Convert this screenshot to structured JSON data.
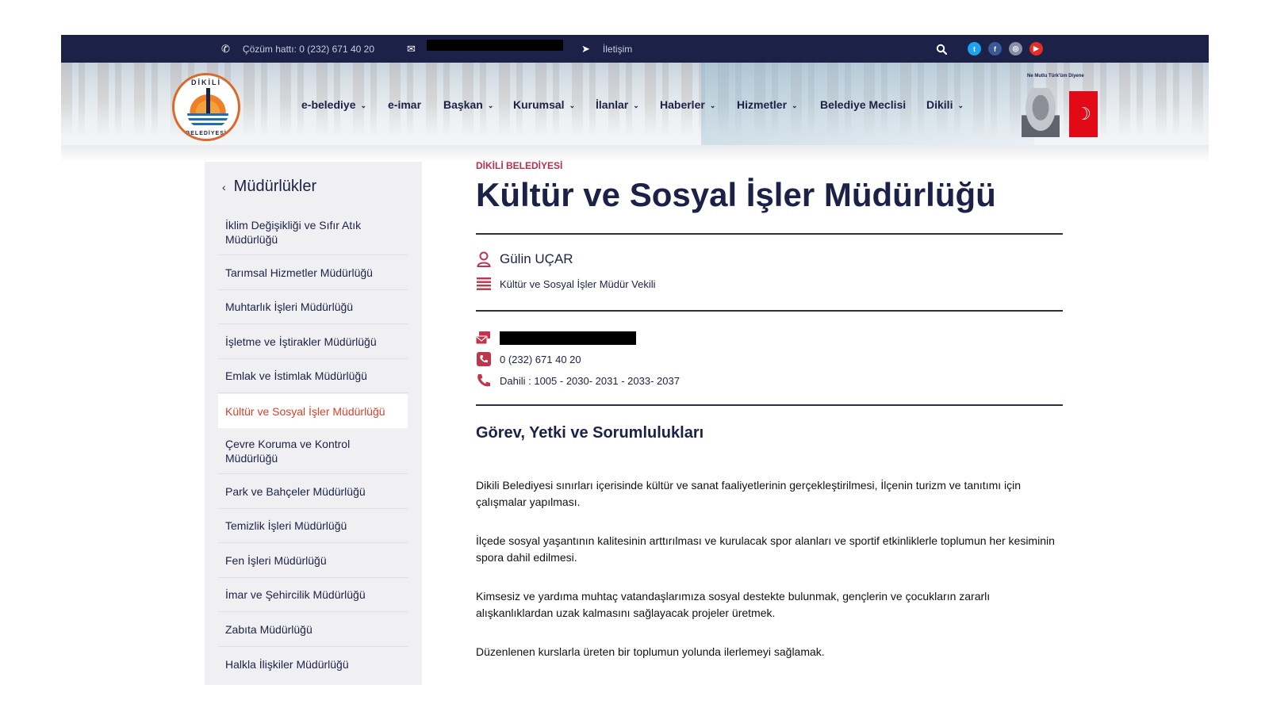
{
  "topbar": {
    "hotline_label": "Çözüm hattı: 0 (232) 671 40 20",
    "contact_label": "İletişim",
    "social": [
      {
        "name": "twitter",
        "color": "#1da1f2",
        "glyph": "t"
      },
      {
        "name": "facebook",
        "color": "#3b5998",
        "glyph": "f"
      },
      {
        "name": "instagram",
        "color": "#8a8fa8",
        "glyph": "◎"
      },
      {
        "name": "youtube",
        "color": "#e52d27",
        "glyph": "▶"
      }
    ]
  },
  "header": {
    "logo_text_top": "DİKİLİ",
    "logo_text_bottom": "BELEDİYESİ",
    "motto": "Ne Mutlu Türk'üm Diyene",
    "nav": [
      {
        "label": "e-belediye",
        "dropdown": true
      },
      {
        "label": "e-imar",
        "dropdown": false
      },
      {
        "label": "Başkan",
        "dropdown": true
      },
      {
        "label": "Kurumsal",
        "dropdown": true
      },
      {
        "label": "İlanlar",
        "dropdown": true
      },
      {
        "label": "Haberler",
        "dropdown": true
      },
      {
        "label": "Hizmetler",
        "dropdown": true
      },
      {
        "label": "Belediye Meclisi",
        "dropdown": false
      },
      {
        "label": "Dikili",
        "dropdown": true
      }
    ]
  },
  "sidebar": {
    "title": "Müdürlükler",
    "items": [
      {
        "label": "İklim Değişikliği ve Sıfır Atık Müdürlüğü",
        "active": false
      },
      {
        "label": "Tarımsal Hizmetler Müdürlüğü",
        "active": false
      },
      {
        "label": "Muhtarlık İşleri Müdürlüğü",
        "active": false
      },
      {
        "label": "İşletme ve İştirakler Müdürlüğü",
        "active": false
      },
      {
        "label": "Emlak ve İstimlak Müdürlüğü",
        "active": false
      },
      {
        "label": "Kültür ve Sosyal İşler Müdürlüğü",
        "active": true
      },
      {
        "label": "Çevre Koruma ve Kontrol Müdürlüğü",
        "active": false
      },
      {
        "label": "Park ve Bahçeler Müdürlüğü",
        "active": false
      },
      {
        "label": "Temizlik İşleri Müdürlüğü",
        "active": false
      },
      {
        "label": "Fen İşleri Müdürlüğü",
        "active": false
      },
      {
        "label": "İmar ve Şehircilik Müdürlüğü",
        "active": false
      },
      {
        "label": "Zabıta Müdürlüğü",
        "active": false
      },
      {
        "label": "Halkla İlişkiler Müdürlüğü",
        "active": false
      }
    ]
  },
  "main": {
    "kicker": "DİKİLİ BELEDİYESİ",
    "title": "Kültür ve Sosyal İşler Müdürlüğü",
    "person_name": "Gülin UÇAR",
    "person_role": "Kültür ve Sosyal İşler Müdür Vekili",
    "phone": "0 (232) 671 40 20",
    "extension": "Dahili : 1005 - 2030- 2031 - 2033- 2037",
    "section_title": "Görev, Yetki ve Sorumlulukları",
    "paragraphs": [
      "Dikili Belediyesi sınırları içerisinde kültür ve sanat faaliyetlerinin gerçekleştirilmesi, İlçenin turizm ve tanıtımı için çalışmalar yapılması.",
      "İlçede sosyal yaşantının kalitesinin arttırılması ve kurulacak spor alanları ve sportif etkinliklerle toplumun her kesiminin spora dahil edilmesi.",
      "Kimsesiz ve yardıma muhtaç vatandaşlarımıza sosyal destekte bulunmak, gençlerin ve çocukların zararlı alışkanlıklardan uzak kalmasını sağlayacak projeler üretmek.",
      "Düzenlenen kurslarla üreten bir toplumun yolunda ilerlemeyi sağlamak."
    ]
  },
  "colors": {
    "navy": "#1c2147",
    "accent_red": "#c0344c",
    "active_orange": "#d9412b"
  }
}
